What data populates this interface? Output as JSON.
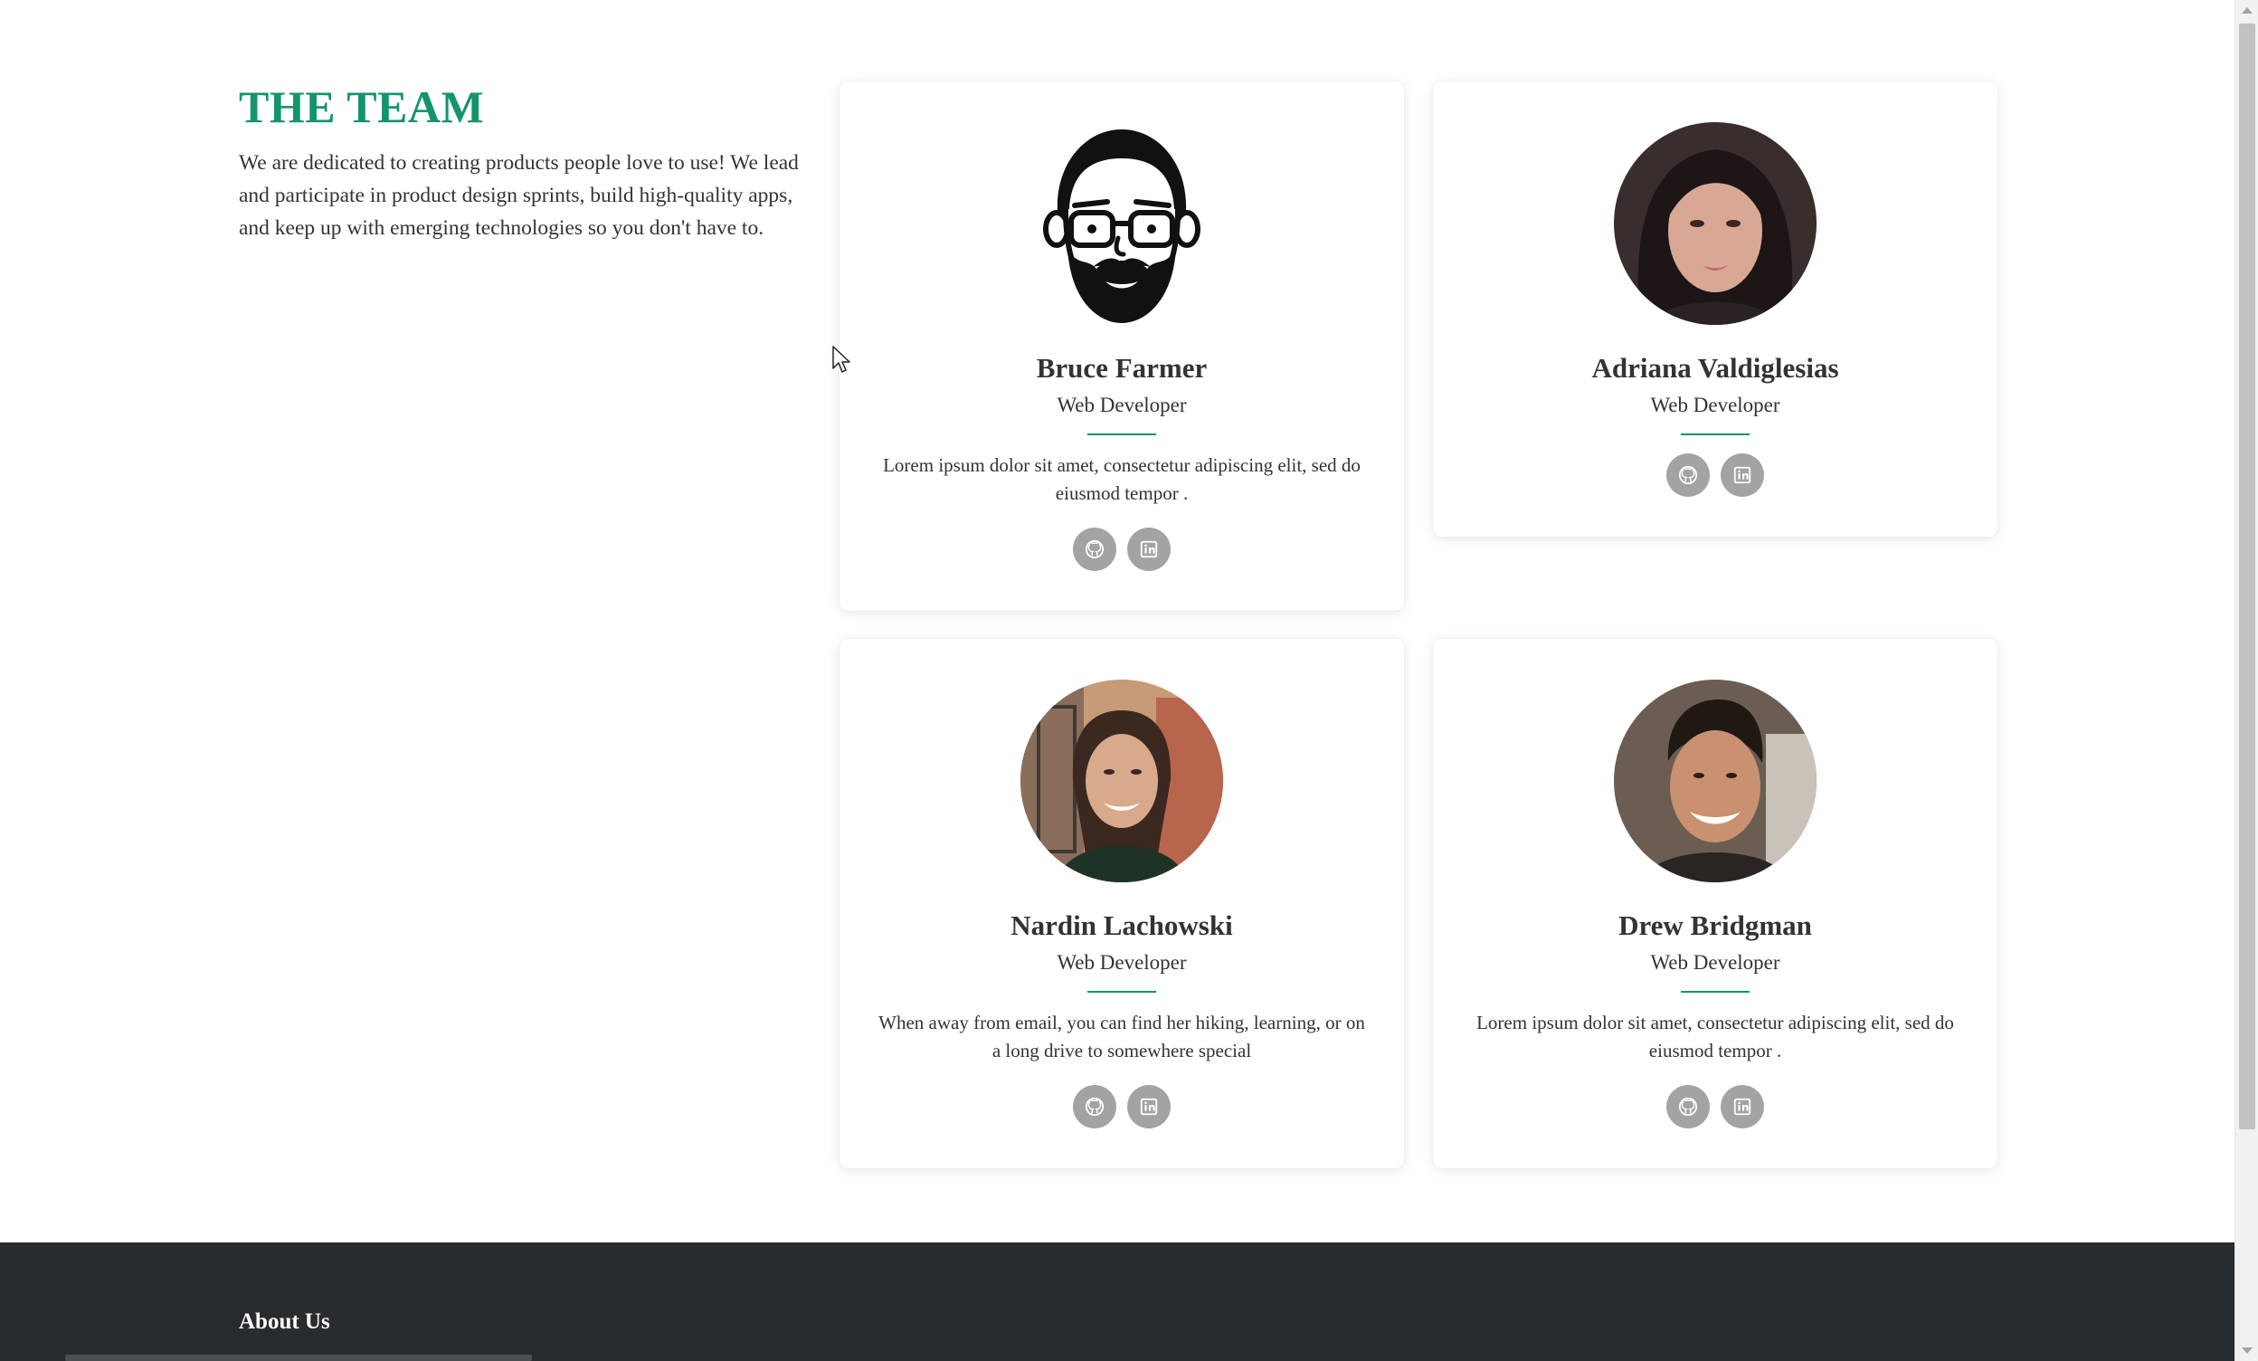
{
  "intro": {
    "title": "THE TEAM",
    "description": "We are dedicated to creating products people love to use! We lead and participate in product design sprints, build high-quality apps, and keep up with emerging technologies so you don't have to."
  },
  "colors": {
    "accent": "#14946d",
    "text": "#333333",
    "social_bg": "#a3a3a6",
    "footer_bg": "#292c2f"
  },
  "team": [
    {
      "name": "Bruce Farmer",
      "role": "Web Developer",
      "bio": "Lorem ipsum dolor sit amet, consectetur adipiscing elit, sed do eiusmod tempor .",
      "avatar": "cartoon-avatar-glasses-beard",
      "socials": [
        "github-icon",
        "linkedin-icon"
      ]
    },
    {
      "name": "Adriana Valdiglesias",
      "role": "Web Developer",
      "bio": "",
      "avatar": "photo-portrait",
      "socials": [
        "github-icon",
        "linkedin-icon"
      ]
    },
    {
      "name": "Nardin Lachowski",
      "role": "Web Developer",
      "bio": "When away from email, you can find her hiking, learning, or on a long drive to somewhere special",
      "avatar": "photo-portrait",
      "socials": [
        "github-icon",
        "linkedin-icon"
      ]
    },
    {
      "name": "Drew Bridgman",
      "role": "Web Developer",
      "bio": "Lorem ipsum dolor sit amet, consectetur adipiscing elit, sed do eiusmod tempor .",
      "avatar": "photo-portrait",
      "socials": [
        "github-icon",
        "linkedin-icon"
      ]
    }
  ],
  "footer": {
    "title": "About Us"
  }
}
